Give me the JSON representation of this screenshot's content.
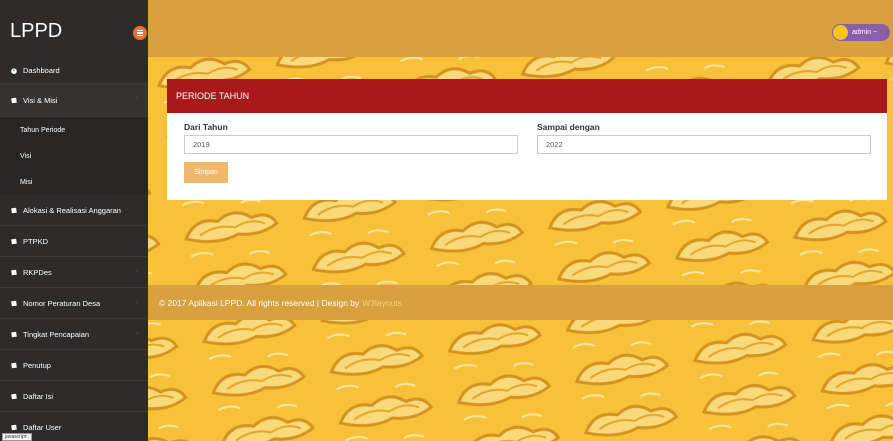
{
  "brand": "LPPD",
  "user": {
    "label": "admin ~"
  },
  "sidebar": {
    "items": [
      {
        "label": "Dashboard"
      },
      {
        "label": "Visi & Misi"
      },
      {
        "label": "Tahun Periode"
      },
      {
        "label": "Visi"
      },
      {
        "label": "Misi"
      },
      {
        "label": "Alokasi & Realisasi Anggaran"
      },
      {
        "label": "PTPKD"
      },
      {
        "label": "RKPDes"
      },
      {
        "label": "Nomor Peraturan Desa"
      },
      {
        "label": "Tingkat Pencapaian"
      },
      {
        "label": "Penutup"
      },
      {
        "label": "Daftar Isi"
      },
      {
        "label": "Daftar User"
      }
    ]
  },
  "panel": {
    "title": "PERIODE TAHUN",
    "from_label": "Dari Tahun",
    "from_value": "2019",
    "to_label": "Sampai dengan",
    "to_value": "2022",
    "save_label": "Simpan"
  },
  "footer": {
    "text": "© 2017 Aplikasi LPPD. All rights reserved | Design by",
    "link": "W3layouts"
  },
  "tooltip": "javascript:;"
}
